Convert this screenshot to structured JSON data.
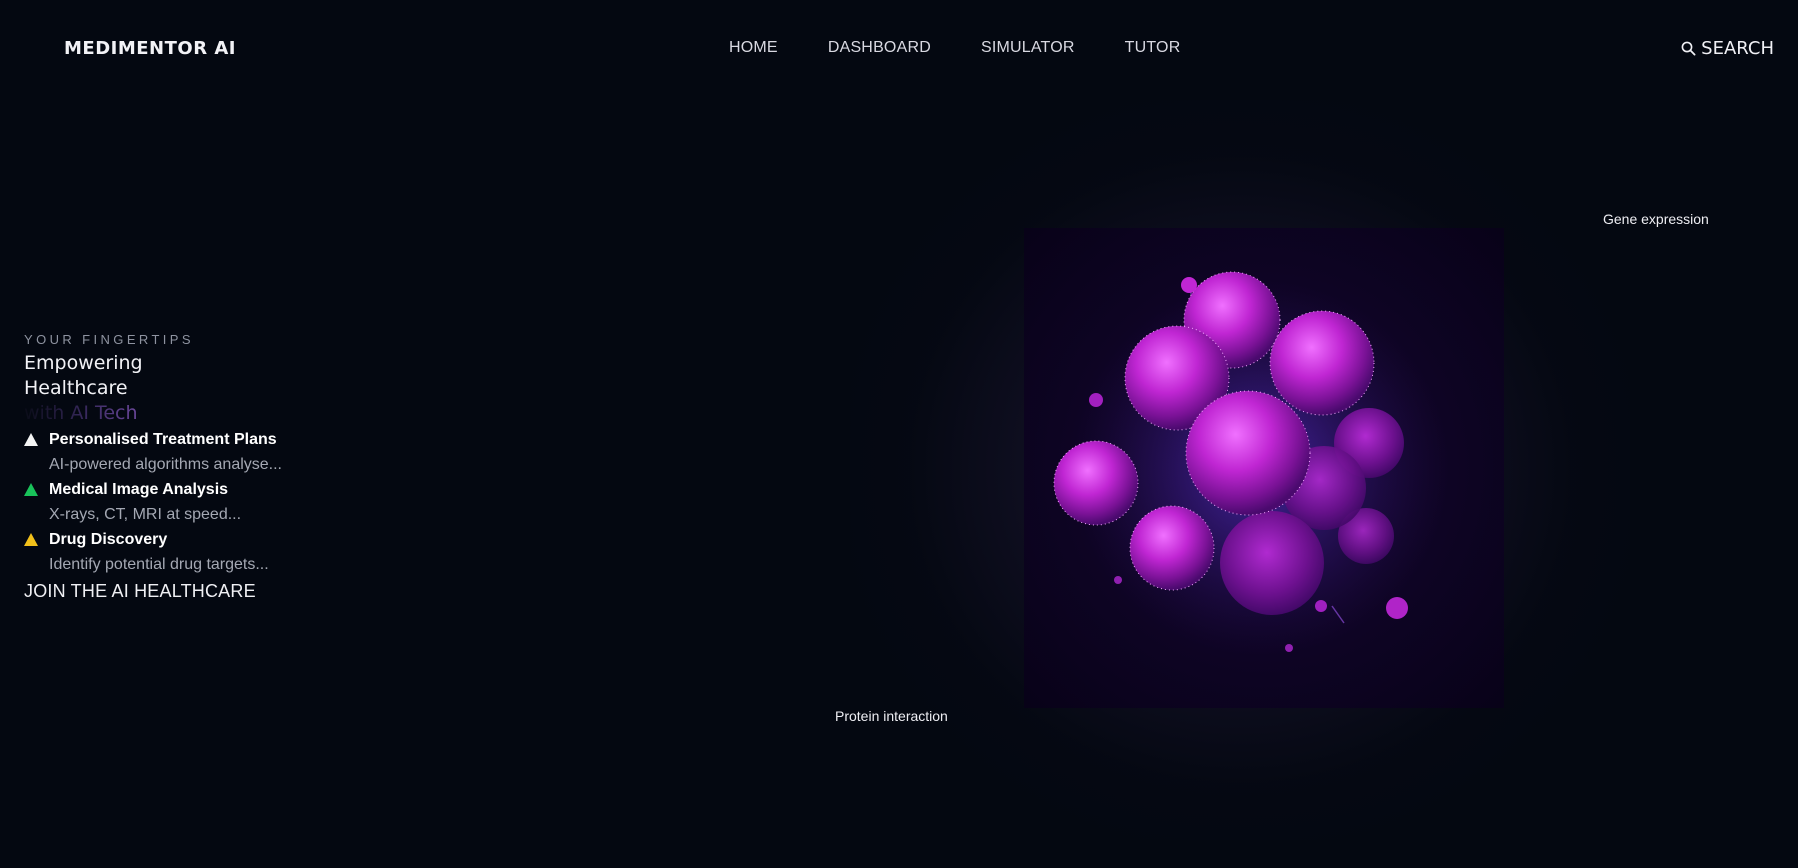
{
  "nav": {
    "brand": "MEDIMENTOR AI",
    "links": [
      "HOME",
      "DASHBOARD",
      "SIMULATOR",
      "TUTOR"
    ],
    "search_label": "SEARCH"
  },
  "hero": {
    "eyebrow": "YOUR FINGERTIPS",
    "headline_line1": "Empowering",
    "headline_line2": "Healthcare",
    "headline_accent": "with AI Tech",
    "features": [
      {
        "title": "Personalised Treatment Plans",
        "desc": "AI-powered algorithms analyse...",
        "color": "#f4f4f4"
      },
      {
        "title": "Medical Image Analysis",
        "desc": "X-rays, CT, MRI at speed...",
        "color": "#19c25a"
      },
      {
        "title": "Drug Discovery",
        "desc": "Identify potential drug targets...",
        "color": "#f2c01a"
      }
    ],
    "cta": "JOIN THE AI HEALTHCARE"
  },
  "visual": {
    "captions": {
      "gene": "Gene expression",
      "protein": "Protein interaction"
    },
    "accent_color": "#c026d3"
  }
}
